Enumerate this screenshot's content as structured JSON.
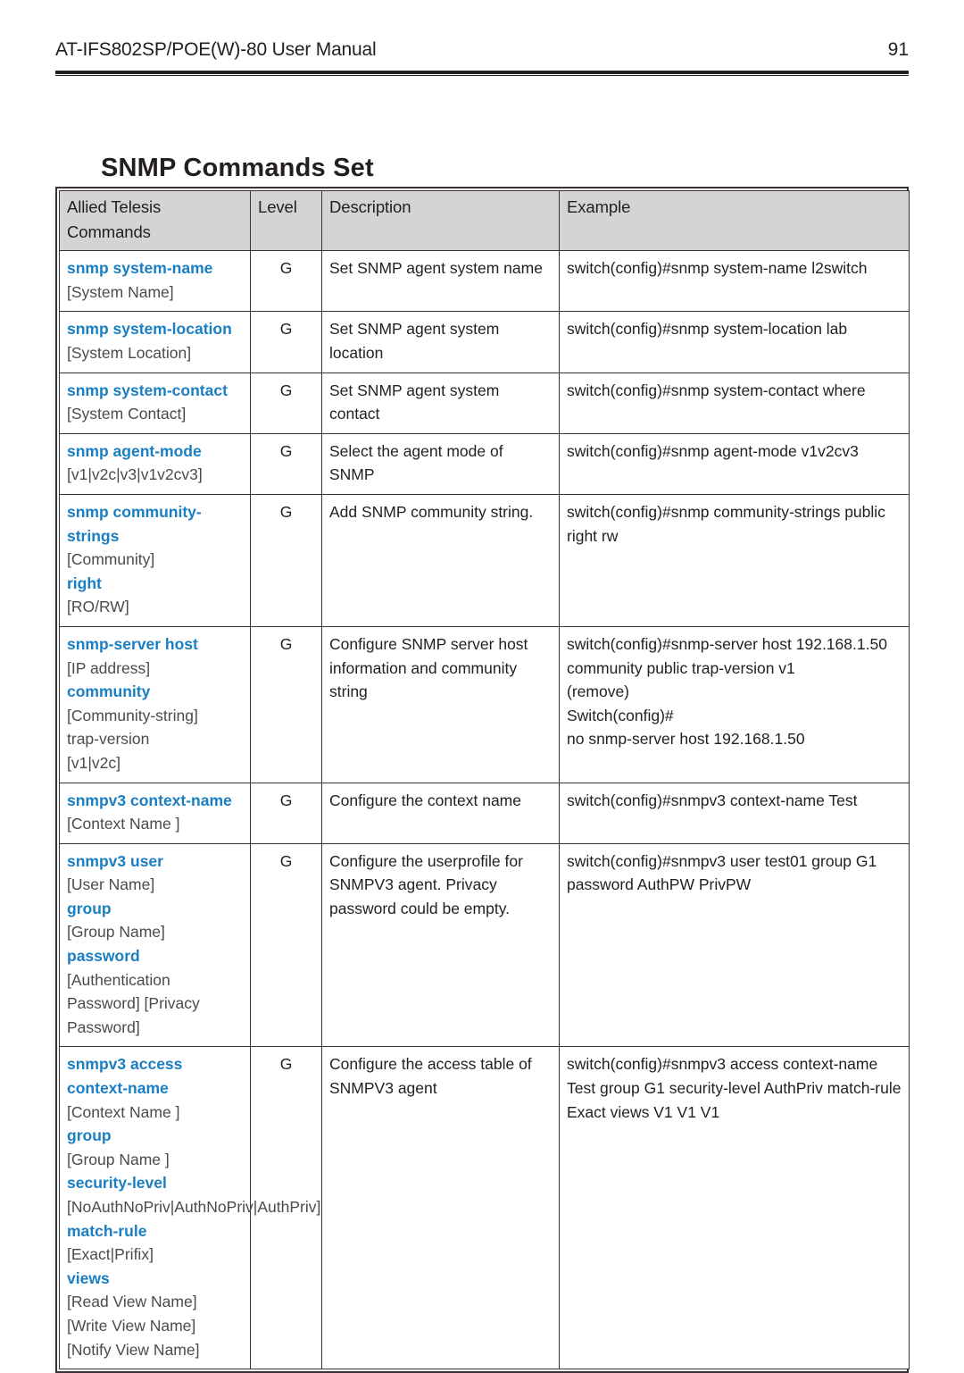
{
  "header": {
    "manual_title": "AT-IFS802SP/POE(W)-80 User Manual",
    "page_number": "91"
  },
  "section": {
    "title": "SNMP Commands Set"
  },
  "table": {
    "columns": [
      "Allied Telesis Commands",
      "Level",
      "Description",
      "Example"
    ],
    "rows": [
      {
        "command_parts": [
          {
            "text": "snmp system-name",
            "style": "kw"
          },
          {
            "text": "[System Name]",
            "style": "arg"
          }
        ],
        "level": "G",
        "description": "Set SNMP agent system name",
        "example": "switch(config)#snmp system-name l2switch"
      },
      {
        "command_parts": [
          {
            "text": "snmp system-location",
            "style": "kw"
          },
          {
            "text": "[System Location]",
            "style": "arg"
          }
        ],
        "level": "G",
        "description": "Set SNMP agent system location",
        "example": "switch(config)#snmp system-location lab"
      },
      {
        "command_parts": [
          {
            "text": "snmp system-contact",
            "style": "kw"
          },
          {
            "text": "[System Contact]",
            "style": "arg"
          }
        ],
        "level": "G",
        "description": "Set SNMP agent system contact",
        "example": "switch(config)#snmp system-contact where"
      },
      {
        "command_parts": [
          {
            "text": "snmp agent-mode",
            "style": "kw"
          },
          {
            "text": "[v1|v2c|v3|v1v2cv3]",
            "style": "arg"
          }
        ],
        "level": "G",
        "description": "Select the agent mode of SNMP",
        "example": "switch(config)#snmp agent-mode v1v2cv3"
      },
      {
        "command_parts": [
          {
            "text": "snmp community-strings",
            "style": "kw"
          },
          {
            "text": "[Community]",
            "style": "arg"
          },
          {
            "text": "right",
            "style": "kw"
          },
          {
            "text": "[RO/RW]",
            "style": "arg"
          }
        ],
        "level": "G",
        "description": "Add SNMP community string.",
        "example": "switch(config)#snmp community-strings public right rw"
      },
      {
        "command_parts": [
          {
            "text": "snmp-server host",
            "style": "kw"
          },
          {
            "text": "[IP address]",
            "style": "arg"
          },
          {
            "text": "community",
            "style": "kw"
          },
          {
            "text": "[Community-string]",
            "style": "arg"
          },
          {
            "text": "trap-version",
            "style": "arg"
          },
          {
            "text": "[v1|v2c]",
            "style": "arg"
          }
        ],
        "level": "G",
        "description": "Configure SNMP server host information and community string",
        "example": "switch(config)#snmp-server host 192.168.1.50 community public trap-version v1\n(remove)\nSwitch(config)#\nno snmp-server host 192.168.1.50"
      },
      {
        "command_parts": [
          {
            "text": "snmpv3 context-name",
            "style": "kw"
          },
          {
            "text": "[Context Name ]",
            "style": "arg"
          }
        ],
        "level": "G",
        "description": "Configure the context name",
        "example": "switch(config)#snmpv3 context-name Test"
      },
      {
        "command_parts": [
          {
            "text": "snmpv3 user",
            "style": "kw"
          },
          {
            "text": "[User Name]",
            "style": "arg"
          },
          {
            "text": "group",
            "style": "kw"
          },
          {
            "text": "[Group Name]",
            "style": "arg"
          },
          {
            "text": "password",
            "style": "kw"
          },
          {
            "text": "[Authentication Password] [Privacy Password]",
            "style": "arg"
          }
        ],
        "level": "G",
        "description": "Configure the userprofile for SNMPV3 agent. Privacy password could be empty.",
        "example": "switch(config)#snmpv3 user test01 group G1 password AuthPW PrivPW"
      },
      {
        "command_parts": [
          {
            "text": "snmpv3 access context-name",
            "style": "kw"
          },
          {
            "text": "[Context Name ]",
            "style": "arg"
          },
          {
            "text": "group",
            "style": "kw"
          },
          {
            "text": "[Group Name ]",
            "style": "arg"
          },
          {
            "text": "security-level",
            "style": "kw"
          },
          {
            "text": "[NoAuthNoPriv|AuthNoPriv|AuthPriv]",
            "style": "arg"
          },
          {
            "text": "match-rule",
            "style": "kw"
          },
          {
            "text": "[Exact|Prifix]",
            "style": "arg"
          },
          {
            "text": "views",
            "style": "kw"
          },
          {
            "text": "[Read View Name]",
            "style": "arg"
          },
          {
            "text": "[Write View Name]",
            "style": "arg"
          },
          {
            "text": "[Notify View Name]",
            "style": "arg"
          }
        ],
        "level": "G",
        "description": "Configure the access table of SNMPV3 agent",
        "example": "switch(config)#snmpv3 access context-name Test group G1 security-level AuthPriv match-rule Exact views V1 V1 V1"
      }
    ]
  },
  "colors": {
    "keyword_blue": "#1a7ec2",
    "argument_gray": "#4b4b4b",
    "header_fill": "#d4d4d4",
    "border": "#3a3238",
    "text": "#231f20"
  }
}
